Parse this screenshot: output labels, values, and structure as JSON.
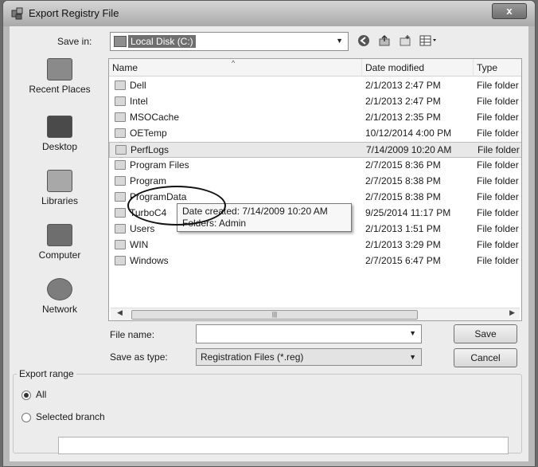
{
  "window": {
    "title": "Export Registry File",
    "close_glyph": "x"
  },
  "toolbar": {
    "save_in_label": "Save in:",
    "save_in_value": "Local Disk (C:)",
    "icons": [
      "back-icon",
      "up-folder-icon",
      "new-folder-icon",
      "view-menu-icon"
    ]
  },
  "places": [
    {
      "label": "Recent Places",
      "icon": "recent-places-icon"
    },
    {
      "label": "Desktop",
      "icon": "desktop-icon"
    },
    {
      "label": "Libraries",
      "icon": "libraries-icon"
    },
    {
      "label": "Computer",
      "icon": "computer-icon"
    },
    {
      "label": "Network",
      "icon": "network-icon"
    }
  ],
  "filelist": {
    "columns": [
      "Name",
      "Date modified",
      "Type"
    ],
    "rows": [
      {
        "name": "Dell",
        "date": "2/1/2013 2:47 PM",
        "type": "File folder"
      },
      {
        "name": "Intel",
        "date": "2/1/2013 2:47 PM",
        "type": "File folder"
      },
      {
        "name": "MSOCache",
        "date": "2/1/2013 2:35 PM",
        "type": "File folder"
      },
      {
        "name": "OETemp",
        "date": "10/12/2014 4:00 PM",
        "type": "File folder"
      },
      {
        "name": "PerfLogs",
        "date": "7/14/2009 10:20 AM",
        "type": "File folder"
      },
      {
        "name": "Program Files",
        "date": "2/7/2015 8:36 PM",
        "type": "File folder"
      },
      {
        "name": "Program",
        "date": "2/7/2015 8:38 PM",
        "type": "File folder"
      },
      {
        "name": "ProgramData",
        "date": "2/7/2015 8:38 PM",
        "type": "File folder"
      },
      {
        "name": "TurboC4",
        "date": "9/25/2014 11:17 PM",
        "type": "File folder"
      },
      {
        "name": "Users",
        "date": "2/1/2013 1:51 PM",
        "type": "File folder"
      },
      {
        "name": "WIN",
        "date": "2/1/2013 3:29 PM",
        "type": "File folder"
      },
      {
        "name": "Windows",
        "date": "2/7/2015 6:47 PM",
        "type": "File folder"
      }
    ],
    "tooltip": {
      "line1": "Date created: 7/14/2009 10:20 AM",
      "line2": "Folders: Admin"
    }
  },
  "form": {
    "file_name_label": "File name:",
    "file_name_value": "",
    "save_type_label": "Save as type:",
    "save_type_value": "Registration Files (*.reg)",
    "save_button": "Save",
    "cancel_button": "Cancel"
  },
  "export_range": {
    "title": "Export range",
    "all_label": "All",
    "selected_label": "Selected branch",
    "selected_value": "",
    "checked": "All"
  }
}
